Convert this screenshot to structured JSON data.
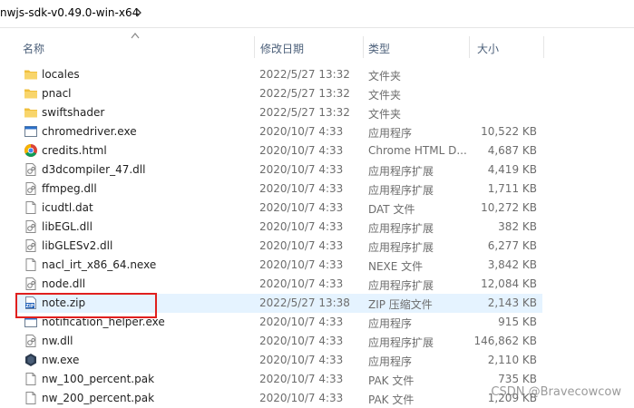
{
  "breadcrumb": {
    "path": "nwjs-sdk-v0.49.0-win-x64"
  },
  "columns": {
    "name": "名称",
    "date": "修改日期",
    "type": "类型",
    "size": "大小"
  },
  "files": [
    {
      "name": "locales",
      "date": "2022/5/27 13:32",
      "type": "文件夹",
      "size": "",
      "icon": "folder-icon"
    },
    {
      "name": "pnacl",
      "date": "2022/5/27 13:32",
      "type": "文件夹",
      "size": "",
      "icon": "folder-icon"
    },
    {
      "name": "swiftshader",
      "date": "2022/5/27 13:32",
      "type": "文件夹",
      "size": "",
      "icon": "folder-icon"
    },
    {
      "name": "chromedriver.exe",
      "date": "2020/10/7 4:33",
      "type": "应用程序",
      "size": "10,522 KB",
      "icon": "exe-window-icon"
    },
    {
      "name": "credits.html",
      "date": "2020/10/7 4:33",
      "type": "Chrome HTML D...",
      "size": "4,687 KB",
      "icon": "chrome-icon"
    },
    {
      "name": "d3dcompiler_47.dll",
      "date": "2020/10/7 4:33",
      "type": "应用程序扩展",
      "size": "4,419 KB",
      "icon": "dll-file-icon"
    },
    {
      "name": "ffmpeg.dll",
      "date": "2020/10/7 4:33",
      "type": "应用程序扩展",
      "size": "1,711 KB",
      "icon": "dll-file-icon"
    },
    {
      "name": "icudtl.dat",
      "date": "2020/10/7 4:33",
      "type": "DAT 文件",
      "size": "10,272 KB",
      "icon": "blank-file-icon"
    },
    {
      "name": "libEGL.dll",
      "date": "2020/10/7 4:33",
      "type": "应用程序扩展",
      "size": "382 KB",
      "icon": "dll-file-icon"
    },
    {
      "name": "libGLESv2.dll",
      "date": "2020/10/7 4:33",
      "type": "应用程序扩展",
      "size": "6,277 KB",
      "icon": "dll-file-icon"
    },
    {
      "name": "nacl_irt_x86_64.nexe",
      "date": "2020/10/7 4:33",
      "type": "NEXE 文件",
      "size": "3,842 KB",
      "icon": "blank-file-icon"
    },
    {
      "name": "node.dll",
      "date": "2020/10/7 4:33",
      "type": "应用程序扩展",
      "size": "12,084 KB",
      "icon": "dll-file-icon"
    },
    {
      "name": "note.zip",
      "date": "2022/5/27 13:38",
      "type": "ZIP 压缩文件",
      "size": "2,143 KB",
      "icon": "zip-icon"
    },
    {
      "name": "notification_helper.exe",
      "date": "2020/10/7 4:33",
      "type": "应用程序",
      "size": "915 KB",
      "icon": "exe-window-icon"
    },
    {
      "name": "nw.dll",
      "date": "2020/10/7 4:33",
      "type": "应用程序扩展",
      "size": "146,862 KB",
      "icon": "dll-file-icon"
    },
    {
      "name": "nw.exe",
      "date": "2020/10/7 4:33",
      "type": "应用程序",
      "size": "2,110 KB",
      "icon": "nwjs-icon"
    },
    {
      "name": "nw_100_percent.pak",
      "date": "2020/10/7 4:33",
      "type": "PAK 文件",
      "size": "735 KB",
      "icon": "blank-file-icon"
    },
    {
      "name": "nw_200_percent.pak",
      "date": "2020/10/7 4:33",
      "type": "PAK 文件",
      "size": "1,209 KB",
      "icon": "blank-file-icon"
    }
  ],
  "watermark": "CSDN @Bravecowcow",
  "colors": {
    "folder": "#f7cf5a",
    "selection": "#e5f3ff",
    "highlight_box": "#e0201e",
    "exe_blue": "#2a6fc9"
  }
}
